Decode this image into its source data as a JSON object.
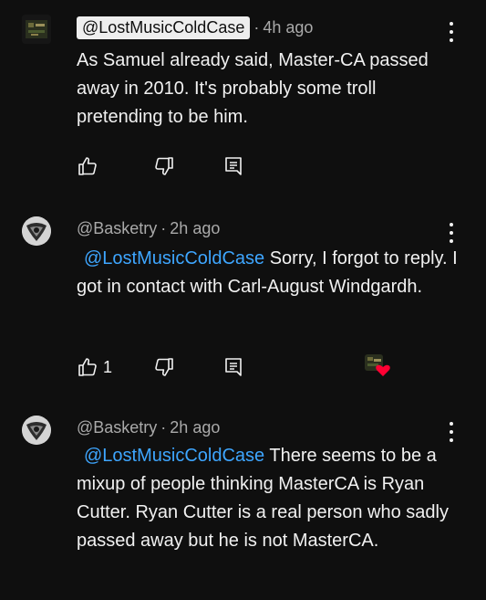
{
  "comments": [
    {
      "handle": "@LostMusicColdCase",
      "time": "4h ago",
      "text": "As Samuel already said, Master-CA passed away in 2010. It's probably some troll pretending to be him.",
      "likes": ""
    },
    {
      "handle": "@Basketry",
      "time": "2h ago",
      "mention": "@LostMusicColdCase",
      "text": " Sorry, I forgot to reply. I got in contact with Carl-August Windgardh.",
      "likes": "1"
    },
    {
      "handle": "@Basketry",
      "time": "2h ago",
      "mention": "@LostMusicColdCase",
      "text": " There seems to be a mixup of people thinking MasterCA is Ryan Cutter. Ryan Cutter is a real person who sadly passed away but he is not MasterCA."
    }
  ],
  "colors": {
    "background": "#0f0f0f",
    "mention": "#3ea6ff",
    "heart": "#ff0033",
    "meta": "#aaaaaa"
  }
}
